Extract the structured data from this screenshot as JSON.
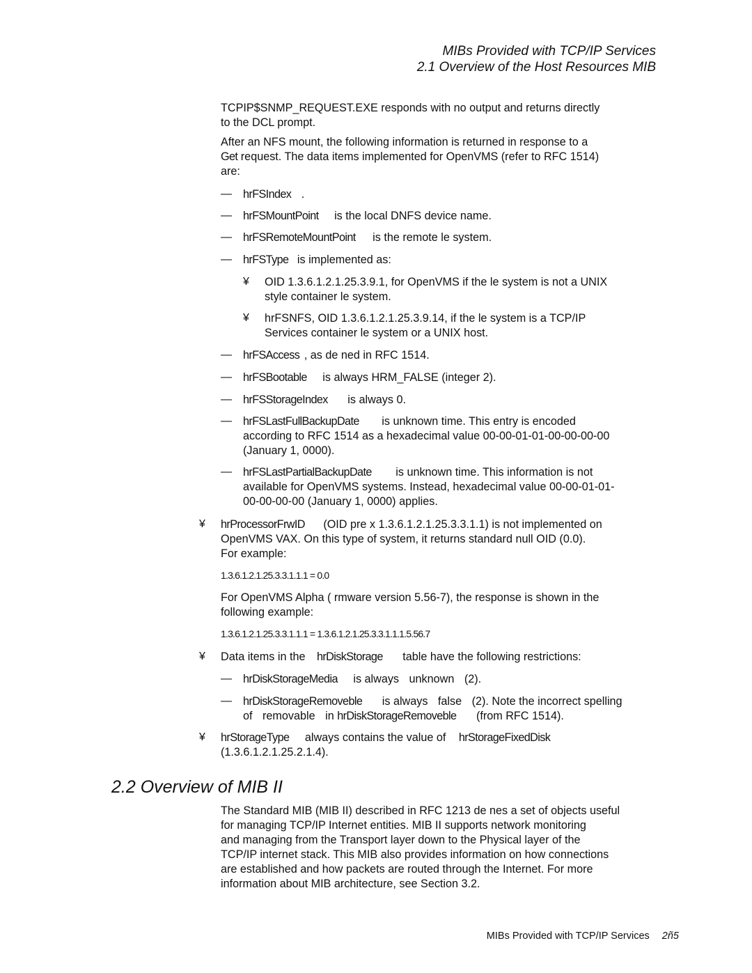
{
  "header": {
    "chapter": "MIBs Provided with TCP/IP Services",
    "section": "2.1 Overview of the Host Resources MIB"
  },
  "intro": {
    "p1": [
      "TCPIP$SNMP_REQUEST.EXE responds with no output and returns directly",
      "to the DCL prompt."
    ],
    "p2": [
      "After an NFS mount, the following information is returned in response to a",
      "request.  The data items implemented for OpenVMS (refer to RFC 1514)",
      "are:"
    ],
    "p2_get": "Get"
  },
  "dash_marker": "—",
  "bullet_marker": "¥",
  "fs_items": [
    {
      "name": "hrFSIndex",
      "text": "."
    },
    {
      "name": "hrFSMountPoint",
      "text": "is the local DNFS device name."
    },
    {
      "name": "hrFSRemoteMountPoint",
      "text": "is the remote  le system."
    },
    {
      "name": "hrFSType",
      "text": "is implemented as:"
    }
  ],
  "fstype_bullets": [
    {
      "lines": [
        "OID 1.3.6.1.2.1.25.3.9.1, for OpenVMS if the  le system is not a UNIX",
        "style container  le system."
      ]
    },
    {
      "lines": [
        "hrFSNFS, OID 1.3.6.1.2.1.25.3.9.14, if the  le system is a TCP/IP",
        "Services container  le system or a UNIX host."
      ]
    }
  ],
  "fs_items2": [
    {
      "name": "hrFSAccess",
      "text": ", as de ned in RFC 1514."
    },
    {
      "name": "hrFSBootable",
      "text": "is always HRM_FALSE (integer 2)."
    },
    {
      "name": "hrFSStorageIndex",
      "text": "is always 0."
    }
  ],
  "backup_items": [
    {
      "name": "hrFSLastFullBackupDate",
      "text": "is unknown time.  This entry is encoded",
      "more": [
        "according to RFC 1514 as a hexadecimal value 00-00-01-01-00-00-00-00",
        "(January 1, 0000)."
      ]
    },
    {
      "name": "hrFSLastPartialBackupDate",
      "text": "is unknown time.  This information is not",
      "more": [
        "available for OpenVMS systems.  Instead, hexadecimal value 00-00-01-01-",
        "00-00-00-00 (January 1, 0000) applies."
      ]
    }
  ],
  "processor": {
    "name": "hrProcessorFrwID",
    "text": "(OID pre x 1.3.6.1.2.1.25.3.3.1.1) is not implemented on",
    "more": [
      "OpenVMS VAX. On this type of system, it returns standard null OID (0.0).",
      "For example:"
    ],
    "example1": "1.3.6.1.2.1.25.3.3.1.1.1  =  0.0",
    "alpha_text": [
      "For OpenVMS Alpha ( rmware version 5.56-7), the response is shown in the",
      "following example:"
    ],
    "example2": "1.3.6.1.2.1.25.3.3.1.1.1  =  1.3.6.1.2.1.25.3.3.1.1.1.5.56.7"
  },
  "disk": {
    "lead": "Data items in the",
    "table": "hrDiskStorage",
    "tail": "table have the following restrictions:",
    "media": {
      "name": "hrDiskStorageMedia",
      "a": "is always",
      "b": "unknown",
      "c": "(2)."
    },
    "removeble": {
      "name": "hrDiskStorageRemoveble",
      "a": "is always",
      "b": "false",
      "c": "(2).  Note the incorrect spelling",
      "l2a": "of",
      "l2b": "removable",
      "l2c": "in",
      "l2d": "hrDiskStorageRemoveble",
      "l2e": "(from RFC 1514)."
    }
  },
  "storage": {
    "name": "hrStorageType",
    "text": "always contains the value of",
    "value": "hrStorageFixedDisk",
    "oid": "(1.3.6.1.2.1.25.2.1.4)."
  },
  "section22": {
    "title": "2.2  Overview of MIB II",
    "lines": [
      "The Standard MIB (MIB II) described in RFC 1213 de nes a set of objects useful",
      "for managing TCP/IP Internet entities.  MIB II supports network monitoring",
      "and managing from the Transport layer down to the Physical layer of the",
      "TCP/IP internet stack.  This MIB also provides information on how connections",
      "are established and how packets are routed through the Internet.  For more",
      "information about MIB architecture, see Section 3.2."
    ]
  },
  "footer": {
    "title": "MIBs Provided with TCP/IP Services",
    "page": "2ñ5"
  }
}
